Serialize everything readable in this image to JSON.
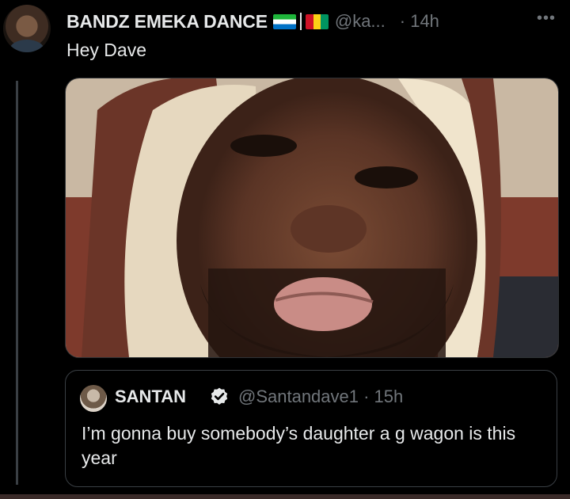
{
  "tweet": {
    "author_name": "BANDZ EMEKA DANCE",
    "handle": "@ka...",
    "time": "· 14h",
    "more_icon": "•••",
    "text": "Hey Dave",
    "flags": [
      "sierra-leone-flag",
      "guinea-flag"
    ]
  },
  "quote": {
    "author_name": "SANTAN",
    "handle": "@Santandave1 · 15h",
    "text": "I’m gonna buy somebody’s daughter a g wagon is this year",
    "verified_icon": "verified-badge-icon"
  },
  "colors": {
    "background": "#000000",
    "text": "#e7e9ea",
    "muted": "#71767b",
    "border": "#3a3f44"
  }
}
